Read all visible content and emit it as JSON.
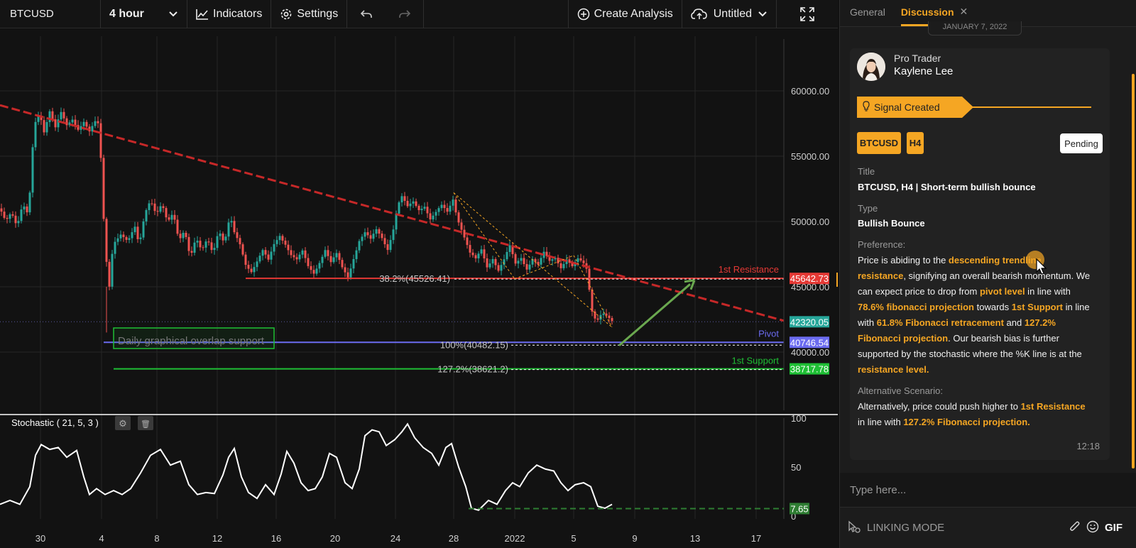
{
  "toolbar": {
    "symbol": "BTCUSD",
    "interval": "4 hour",
    "indicators_label": "Indicators",
    "settings_label": "Settings",
    "create_analysis_label": "Create Analysis",
    "layout_name": "Untitled"
  },
  "chart": {
    "price_axis_labels": [
      {
        "value": 60000,
        "text": "60000.00"
      },
      {
        "value": 55000,
        "text": "55000.00"
      },
      {
        "value": 50000,
        "text": "50000.00"
      },
      {
        "value": 45000,
        "text": "45000.00"
      },
      {
        "value": 40000,
        "text": "40000.00"
      }
    ],
    "price_tags": [
      {
        "name": "resistance-price-tag",
        "text": "45642.73",
        "value": 45642.73,
        "color": "#e53935"
      },
      {
        "name": "current-price-tag",
        "text": "42320.05",
        "value": 42320.05,
        "color": "#26a69a"
      },
      {
        "name": "pivot-price-tag",
        "text": "40746.54",
        "value": 40746.54,
        "color": "#6b6bf0"
      },
      {
        "name": "support-price-tag",
        "text": "38717.78",
        "value": 38717.78,
        "color": "#1fbf35"
      }
    ],
    "x_ticks": [
      "30",
      "4",
      "8",
      "12",
      "16",
      "20",
      "24",
      "28",
      "2022",
      "5",
      "9",
      "13",
      "17"
    ],
    "labels": {
      "resistance": "1st Resistance",
      "pivot": "Pivot",
      "support": "1st Support",
      "fib_382": "38.2%(45526.41)",
      "fib_100": "100%(40482.15)",
      "fib_1272": "127.2%(38621.2)",
      "overlap_box": "Daily graphical overlap support"
    },
    "colors": {
      "up": "#26a69a",
      "down": "#ef5350",
      "trendline": "#c62828",
      "resistance": "#e53935",
      "pivot": "#6b6bf0",
      "support": "#1fbf35",
      "projection_arrow": "#6aa84f",
      "fib": "#f5a623"
    },
    "close_path": [
      [
        0,
        51000
      ],
      [
        8,
        50200
      ],
      [
        16,
        50900
      ],
      [
        24,
        49600
      ],
      [
        32,
        51200
      ],
      [
        40,
        50300
      ],
      [
        48,
        57400
      ],
      [
        56,
        58400
      ],
      [
        62,
        57000
      ],
      [
        70,
        58500
      ],
      [
        78,
        57100
      ],
      [
        86,
        58200
      ],
      [
        94,
        57300
      ],
      [
        102,
        57900
      ],
      [
        110,
        57200
      ],
      [
        118,
        57700
      ],
      [
        126,
        56800
      ],
      [
        134,
        57500
      ],
      [
        140,
        57300
      ],
      [
        145,
        51000
      ],
      [
        150,
        47000
      ],
      [
        152,
        42500
      ],
      [
        155,
        46500
      ],
      [
        160,
        48500
      ],
      [
        170,
        49000
      ],
      [
        180,
        48300
      ],
      [
        190,
        49500
      ],
      [
        196,
        48200
      ],
      [
        204,
        50800
      ],
      [
        212,
        51800
      ],
      [
        220,
        50500
      ],
      [
        228,
        51200
      ],
      [
        236,
        49800
      ],
      [
        244,
        50700
      ],
      [
        252,
        48700
      ],
      [
        260,
        49500
      ],
      [
        268,
        47200
      ],
      [
        276,
        48600
      ],
      [
        284,
        47600
      ],
      [
        292,
        48700
      ],
      [
        300,
        47700
      ],
      [
        308,
        49500
      ],
      [
        316,
        48300
      ],
      [
        324,
        50300
      ],
      [
        330,
        49000
      ],
      [
        338,
        48200
      ],
      [
        346,
        46800
      ],
      [
        354,
        46300
      ],
      [
        362,
        47000
      ],
      [
        370,
        47700
      ],
      [
        378,
        46900
      ],
      [
        386,
        48200
      ],
      [
        394,
        49000
      ],
      [
        402,
        48400
      ],
      [
        410,
        47500
      ],
      [
        418,
        47000
      ],
      [
        426,
        47600
      ],
      [
        434,
        46500
      ],
      [
        442,
        46100
      ],
      [
        450,
        47000
      ],
      [
        458,
        47900
      ],
      [
        466,
        46800
      ],
      [
        474,
        47400
      ],
      [
        482,
        46400
      ],
      [
        490,
        45800
      ],
      [
        498,
        47300
      ],
      [
        506,
        48600
      ],
      [
        514,
        49100
      ],
      [
        522,
        48500
      ],
      [
        530,
        49300
      ],
      [
        538,
        48800
      ],
      [
        546,
        48000
      ],
      [
        554,
        49500
      ],
      [
        560,
        51200
      ],
      [
        566,
        51800
      ],
      [
        574,
        51000
      ],
      [
        582,
        51500
      ],
      [
        590,
        51000
      ],
      [
        598,
        51300
      ],
      [
        606,
        50200
      ],
      [
        614,
        50600
      ],
      [
        622,
        51100
      ],
      [
        630,
        50700
      ],
      [
        638,
        51800
      ],
      [
        644,
        50400
      ],
      [
        650,
        49500
      ],
      [
        656,
        48500
      ],
      [
        662,
        47500
      ],
      [
        670,
        47000
      ],
      [
        678,
        47800
      ],
      [
        686,
        46600
      ],
      [
        694,
        47300
      ],
      [
        702,
        46300
      ],
      [
        710,
        47000
      ],
      [
        718,
        48000
      ],
      [
        726,
        46700
      ],
      [
        734,
        47300
      ],
      [
        742,
        46500
      ],
      [
        750,
        47200
      ],
      [
        758,
        46600
      ],
      [
        766,
        47500
      ],
      [
        774,
        46900
      ],
      [
        782,
        47300
      ],
      [
        790,
        46600
      ],
      [
        798,
        47200
      ],
      [
        806,
        46500
      ],
      [
        814,
        47000
      ],
      [
        822,
        46700
      ],
      [
        828,
        46200
      ],
      [
        832,
        43500
      ],
      [
        840,
        42500
      ],
      [
        848,
        43100
      ],
      [
        856,
        42600
      ],
      [
        862,
        42200
      ]
    ],
    "stochastic": {
      "label": "Stochastic ( 21, 5, 3 )",
      "axis_labels": [
        "100",
        "50",
        "0"
      ],
      "current_text": "7.65",
      "points": [
        [
          0,
          12
        ],
        [
          14,
          16
        ],
        [
          28,
          12
        ],
        [
          42,
          30
        ],
        [
          50,
          62
        ],
        [
          58,
          73
        ],
        [
          70,
          68
        ],
        [
          82,
          70
        ],
        [
          94,
          60
        ],
        [
          108,
          67
        ],
        [
          118,
          40
        ],
        [
          126,
          22
        ],
        [
          136,
          28
        ],
        [
          148,
          22
        ],
        [
          160,
          26
        ],
        [
          172,
          22
        ],
        [
          184,
          28
        ],
        [
          198,
          44
        ],
        [
          212,
          62
        ],
        [
          226,
          68
        ],
        [
          240,
          52
        ],
        [
          254,
          56
        ],
        [
          266,
          32
        ],
        [
          278,
          22
        ],
        [
          290,
          24
        ],
        [
          302,
          23
        ],
        [
          314,
          42
        ],
        [
          322,
          60
        ],
        [
          330,
          69
        ],
        [
          340,
          40
        ],
        [
          350,
          24
        ],
        [
          362,
          18
        ],
        [
          374,
          32
        ],
        [
          386,
          22
        ],
        [
          396,
          43
        ],
        [
          404,
          66
        ],
        [
          414,
          54
        ],
        [
          424,
          34
        ],
        [
          434,
          26
        ],
        [
          444,
          28
        ],
        [
          454,
          40
        ],
        [
          464,
          64
        ],
        [
          474,
          60
        ],
        [
          486,
          34
        ],
        [
          496,
          28
        ],
        [
          506,
          48
        ],
        [
          514,
          82
        ],
        [
          524,
          88
        ],
        [
          534,
          86
        ],
        [
          544,
          72
        ],
        [
          556,
          78
        ],
        [
          566,
          86
        ],
        [
          574,
          94
        ],
        [
          584,
          80
        ],
        [
          596,
          70
        ],
        [
          608,
          64
        ],
        [
          618,
          52
        ],
        [
          628,
          70
        ],
        [
          636,
          74
        ],
        [
          646,
          50
        ],
        [
          656,
          30
        ],
        [
          664,
          8
        ],
        [
          674,
          6
        ],
        [
          688,
          16
        ],
        [
          700,
          12
        ],
        [
          712,
          26
        ],
        [
          722,
          34
        ],
        [
          732,
          30
        ],
        [
          744,
          44
        ],
        [
          756,
          52
        ],
        [
          768,
          48
        ],
        [
          780,
          46
        ],
        [
          790,
          34
        ],
        [
          800,
          26
        ],
        [
          810,
          32
        ],
        [
          822,
          34
        ],
        [
          832,
          30
        ],
        [
          842,
          10
        ],
        [
          852,
          8
        ],
        [
          862,
          12
        ]
      ]
    }
  },
  "sidebar": {
    "tabs": [
      "General",
      "Discussion"
    ],
    "date_divider": "JANUARY 7, 2022",
    "author_role": "Pro Trader",
    "author_name": "Kaylene Lee",
    "signal_label": "Signal Created",
    "chip_symbol": "BTCUSD",
    "chip_timeframe": "H4",
    "status": "Pending",
    "title_label": "Title",
    "title_value": "BTCUSD, H4 | Short-term bullish bounce",
    "type_label": "Type",
    "type_value": "Bullish Bounce",
    "preference_label": "Preference:",
    "preference_parts": [
      {
        "t": "Price is abiding to the ",
        "h": false
      },
      {
        "t": "descending trendline resistance",
        "h": true
      },
      {
        "t": ", signifying an overall bearish momentum. We can expect price to drop from ",
        "h": false
      },
      {
        "t": "pivot level",
        "h": true
      },
      {
        "t": " in line with ",
        "h": false
      },
      {
        "t": "78.6% fibonacci projection",
        "h": true
      },
      {
        "t": " towards ",
        "h": false
      },
      {
        "t": "1st Support",
        "h": true
      },
      {
        "t": " in line with ",
        "h": false
      },
      {
        "t": "61.8% Fibonacci retracement",
        "h": true
      },
      {
        "t": " and ",
        "h": false
      },
      {
        "t": "127.2% Fibonacci projection",
        "h": true
      },
      {
        "t": ". Our bearish bias is further supported by the stochastic where the %K line is at the ",
        "h": false
      },
      {
        "t": "resistance level.",
        "h": true
      }
    ],
    "alt_label": "Alternative Scenario:",
    "alt_parts": [
      {
        "t": "Alternatively, price could push higher to ",
        "h": false
      },
      {
        "t": "1st Resistance",
        "h": true
      },
      {
        "t": " in line with ",
        "h": false
      },
      {
        "t": "127.2% Fibonacci projection.",
        "h": true
      }
    ],
    "message_time": "12:18",
    "composer_placeholder": "Type here...",
    "linking_mode_label": "LINKING MODE",
    "gif_label": "GIF",
    "accent_color": "#f5a623"
  }
}
